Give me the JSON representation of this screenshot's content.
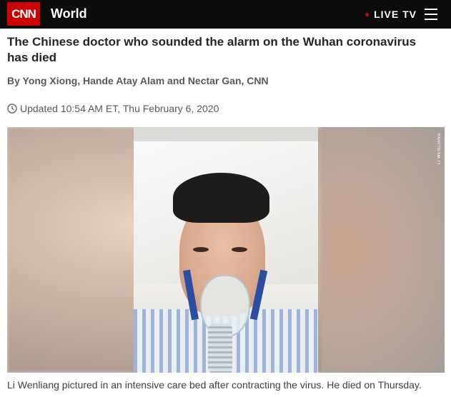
{
  "header": {
    "logo_text": "CNN",
    "section": "World",
    "live_tv": "LIVE TV",
    "menu_icon": "hamburger-menu-icon"
  },
  "article": {
    "headline": "The Chinese doctor who sounded the alarm on the Wuhan coronavirus has died",
    "byline": "By Yong Xiong, Hande Atay Alam and Nectar Gan, CNN",
    "updated": "Updated 10:54 AM ET, Thu February 6, 2020",
    "image": {
      "credit": "LI WENLIANG",
      "caption": "Li Wenliang pictured in an intensive care bed after contracting the virus. He died on Thursday."
    }
  },
  "colors": {
    "brand_red": "#cc0000",
    "header_bg": "#0c0c0c"
  }
}
